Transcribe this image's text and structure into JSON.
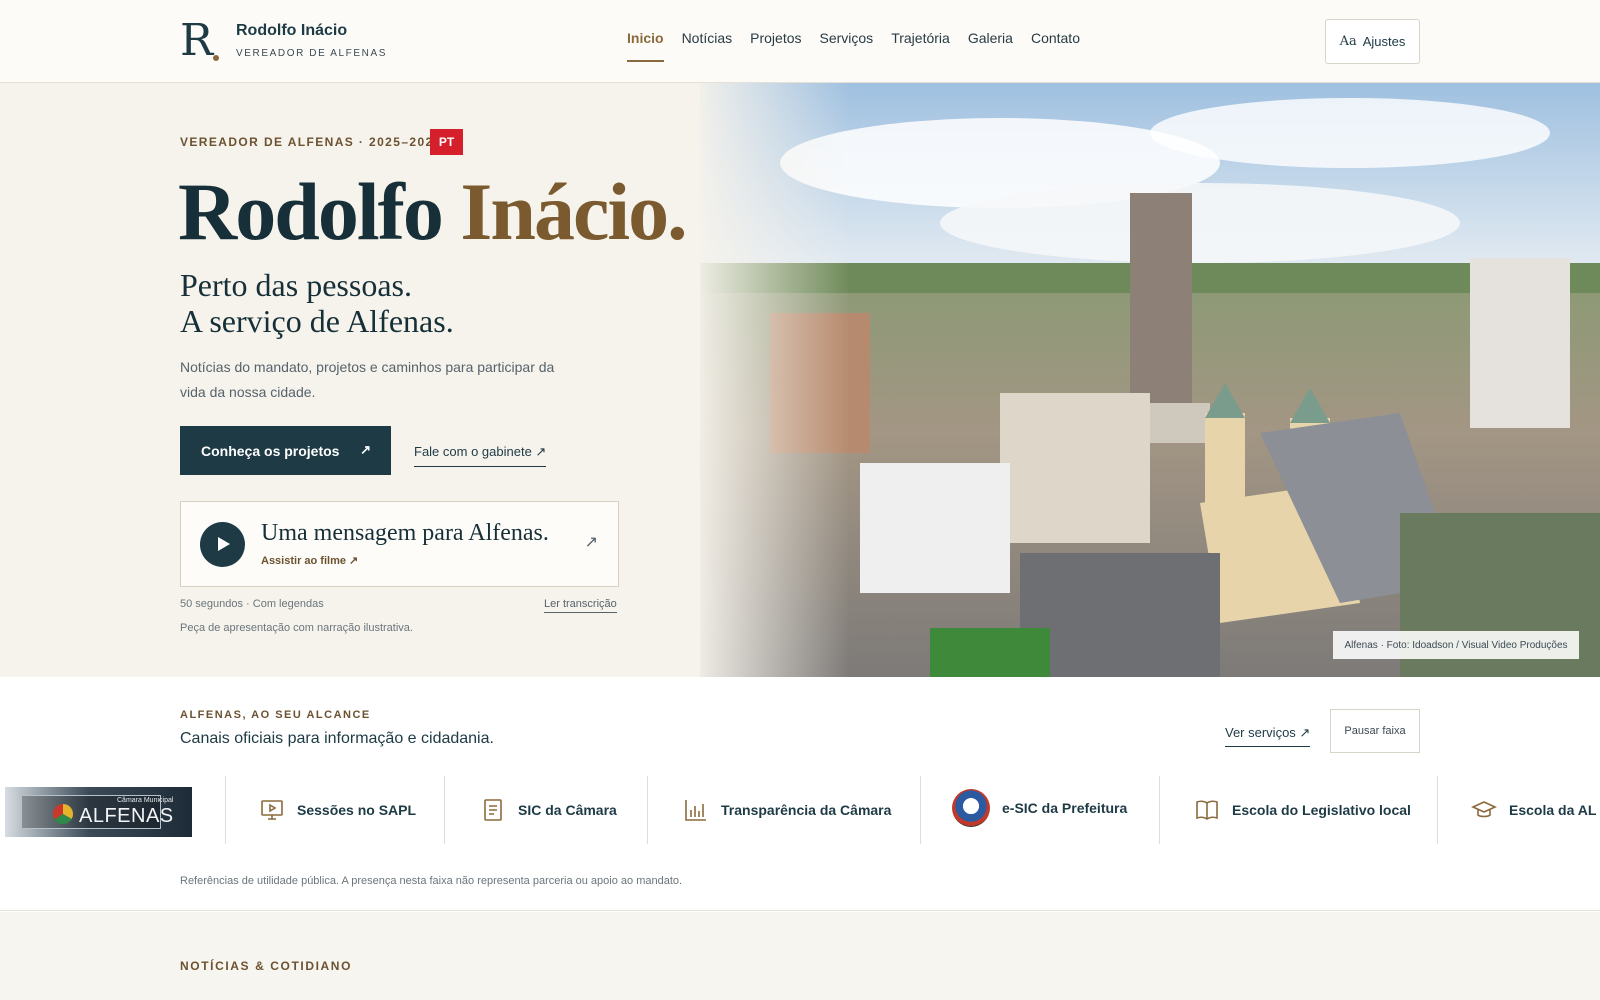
{
  "header": {
    "logo_letter": "R",
    "brand_name": "Rodolfo Inácio",
    "brand_sub": "VEREADOR DE ALFENAS",
    "nav": [
      {
        "label": "Inicio",
        "active": true
      },
      {
        "label": "Notícias"
      },
      {
        "label": "Projetos"
      },
      {
        "label": "Serviços"
      },
      {
        "label": "Trajetória"
      },
      {
        "label": "Galeria"
      },
      {
        "label": "Contato"
      }
    ],
    "settings_icon_text": "Aa",
    "settings_label": "Ajustes"
  },
  "hero": {
    "eyebrow": "VEREADOR DE ALFENAS · 2025–2028",
    "party_badge": "PT",
    "title_first": "Rodolfo",
    "title_accent": "Inácio.",
    "tagline_line1": "Perto das pessoas.",
    "tagline_line2": "A serviço de Alfenas.",
    "description": "Notícias do mandato, projetos e caminhos para participar da vida da nossa cidade.",
    "cta_primary": "Conheça os projetos",
    "cta_primary_arrow": "↗",
    "cta_secondary": "Fale com o gabinete ↗",
    "video": {
      "title": "Uma mensagem para Alfenas.",
      "link": "Assistir ao filme ↗",
      "arrow": "↗",
      "meta": "50 segundos · Com legendas",
      "transcript": "Ler transcrição",
      "note": "Peça de apresentação com narração ilustrativa."
    },
    "photo_credit": "Alfenas · Foto: Idoadson / Visual Video Produções"
  },
  "services": {
    "eyebrow": "ALFENAS, AO SEU ALCANCE",
    "title": "Canais oficiais para informação e cidadania.",
    "link": "Ver serviços ↗",
    "pause_label": "Pausar faixa",
    "logo_small": "Câmara Municipal",
    "logo_text": "ALFENAS",
    "items": [
      {
        "label": "Sessões no SAPL",
        "icon": "presentation-icon"
      },
      {
        "label": "SIC da Câmara",
        "icon": "document-icon"
      },
      {
        "label": "Transparência da Câmara",
        "icon": "bar-chart-icon"
      },
      {
        "label": "e-SIC da Prefeitura",
        "icon": "crest-icon"
      },
      {
        "label": "Escola do Legislativo local",
        "icon": "book-icon"
      },
      {
        "label": "Escola da AL",
        "icon": "graduation-cap-icon"
      }
    ],
    "footnote": "Referências de utilidade pública. A presença nesta faixa não representa parceria ou apoio ao mandato."
  },
  "news": {
    "eyebrow": "NOTÍCIAS & COTIDIANO"
  },
  "colors": {
    "brand_dark": "#1d3a45",
    "accent_gold": "#7a5a2e",
    "party_red": "#d5202b",
    "hero_bg": "#f6f3ec"
  }
}
